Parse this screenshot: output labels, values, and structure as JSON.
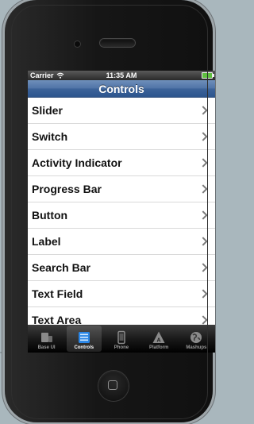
{
  "status_bar": {
    "carrier": "Carrier",
    "time": "11:35 AM"
  },
  "navbar": {
    "title": "Controls"
  },
  "list": {
    "items": [
      {
        "label": "Slider"
      },
      {
        "label": "Switch"
      },
      {
        "label": "Activity Indicator"
      },
      {
        "label": "Progress Bar"
      },
      {
        "label": "Button"
      },
      {
        "label": "Label"
      },
      {
        "label": "Search Bar"
      },
      {
        "label": "Text Field"
      },
      {
        "label": "Text Area"
      }
    ]
  },
  "tabbar": {
    "tabs": [
      {
        "label": "Base UI",
        "icon": "base-ui-icon"
      },
      {
        "label": "Controls",
        "icon": "controls-icon",
        "active": true
      },
      {
        "label": "Phone",
        "icon": "phone-icon"
      },
      {
        "label": "Platform",
        "icon": "platform-icon"
      },
      {
        "label": "Mashups",
        "icon": "mashups-icon"
      }
    ]
  },
  "colors": {
    "navbar": "#3c6399",
    "phone_body": "#161616",
    "background": "#a9b7bd",
    "battery": "#5fbf40"
  }
}
